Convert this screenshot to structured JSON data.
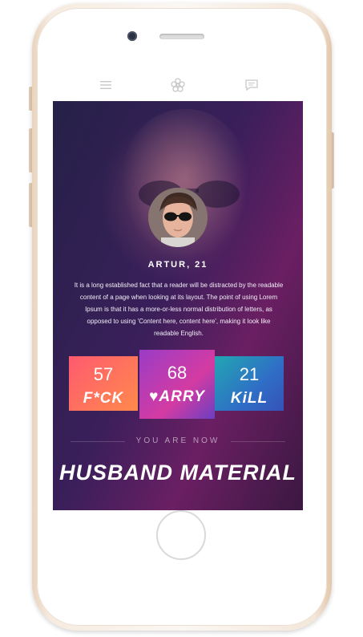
{
  "topbar": {
    "menu_icon": "hamburger-menu-icon",
    "logo_icon": "flower-logo-icon",
    "chat_icon": "chat-bubble-icon"
  },
  "profile": {
    "name": "ARTUR, 21",
    "bio": "It is a long established fact that a reader will be distracted by the readable content of a page when looking at its layout. The point of using Lorem Ipsum is that it has a more-or-less normal distribution of letters, as opposed to using 'Content here, content here', making it look like readable English."
  },
  "cards": [
    {
      "value": "57",
      "label": "F*CK",
      "colors": [
        "#ff5a6f",
        "#ff8a4c"
      ]
    },
    {
      "value": "68",
      "label": "♥ARRY",
      "colors": [
        "#9a3cc6",
        "#d43ba2"
      ]
    },
    {
      "value": "21",
      "label": "KiLL",
      "colors": [
        "#22a6b2",
        "#3552b8"
      ]
    }
  ],
  "result": {
    "subtitle": "YOU ARE NOW",
    "headline": "HUSBAND MATERIAL"
  }
}
